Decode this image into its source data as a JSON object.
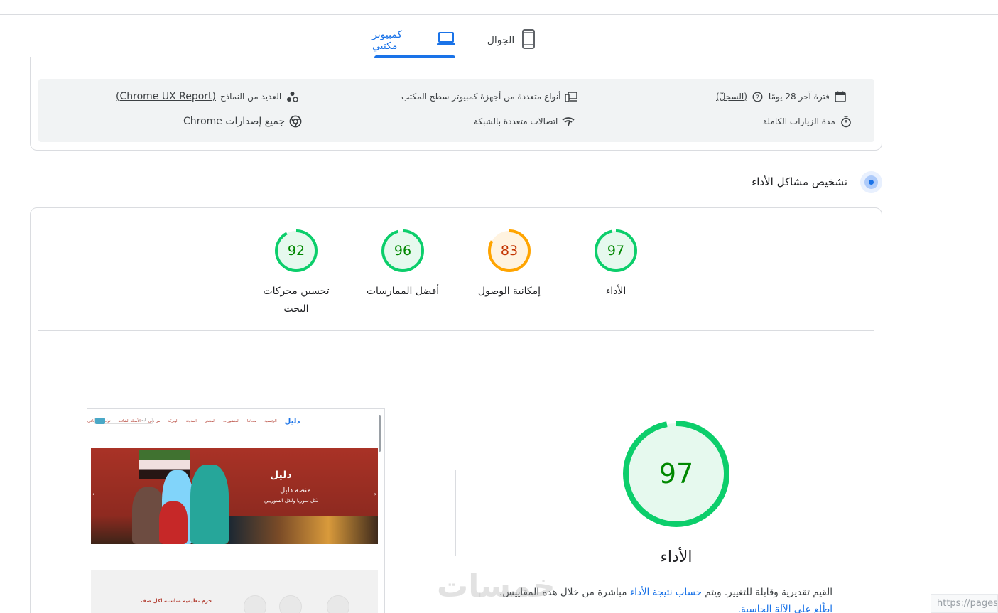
{
  "tabs": [
    {
      "label": "كمبيوتر مكتبي",
      "icon": "laptop-icon",
      "active": true
    },
    {
      "label": "الجوال",
      "icon": "phone-icon",
      "active": false
    }
  ],
  "info": {
    "period": "فترة آخر 28 يومًا",
    "history_link": "(السجلّ)",
    "full_visits": "مدة الزيارات الكاملة",
    "devices": "أنواع متعددة من أجهزة كمبيوتر سطح المكتب",
    "network": "اتصالات متعددة بالشبكة",
    "samples_prefix": "العديد من النماذج",
    "samples_link": "(Chrome UX Report)",
    "chrome_versions": "جميع إصدارات Chrome"
  },
  "diagnose_heading": "تشخيص مشاكل الأداء",
  "categories": [
    {
      "label": "الأداء",
      "score": "97",
      "status": "good",
      "color": "#0cce6b"
    },
    {
      "label": "إمكانية الوصول",
      "score": "83",
      "status": "average",
      "color": "#ffa400"
    },
    {
      "label": "أفضل الممارسات",
      "score": "96",
      "status": "good",
      "color": "#0cce6b"
    },
    {
      "label": "تحسين محركات البحث",
      "score": "92",
      "status": "good",
      "color": "#0cce6b"
    }
  ],
  "performance": {
    "score": "97",
    "title": "الأداء",
    "desc_part1": "القيم تقديرية وقابلة للتغيير. ويتم",
    "desc_link1": "حساب نتيجة الأداء",
    "desc_part2": "مباشرة من خلال هذه المقاييس.",
    "desc_link2": "اطّلع على الآلة الحاسبة."
  },
  "thumbnail": {
    "logo": "دليل",
    "nav": [
      "الرئيسية",
      "منحاتنا",
      "المنشورات",
      "المنتدى",
      "المدونة",
      "الهيركة",
      "من نحن",
      "الأسئلة الشائعة",
      "تواصل اجتماعي"
    ],
    "search_placeholder": "ابحث...",
    "hero_brand": "دليل",
    "hero_line1": "منصة دليل",
    "hero_line2": "لكل سوريا ولكل السوريين",
    "lower_text": "حزم تعليمية مناسبة لكل صف"
  },
  "watermark": "خمسات",
  "url_hint": "https://pages",
  "colors": {
    "accent": "#1a73e8",
    "good": "#0cce6b",
    "average": "#ffa400"
  }
}
